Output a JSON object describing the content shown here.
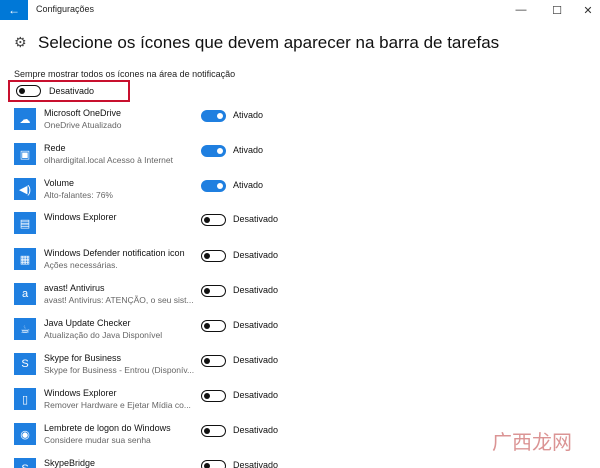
{
  "window": {
    "title": "Configurações",
    "back_icon": "←",
    "minimize_icon": "—",
    "maximize_icon": "☐",
    "close_icon": "✕"
  },
  "header": {
    "gear_icon": "⚙",
    "title": "Selecione os ícones que devem aparecer na barra de tarefas"
  },
  "always_show": {
    "label": "Sempre mostrar todos os ícones na área de notificação",
    "state": "Desativado",
    "on": false
  },
  "colors": {
    "accent": "#1f7fe0",
    "highlight_border": "#c8102e"
  },
  "items": [
    {
      "name": "Microsoft OneDrive",
      "desc": "OneDrive Atualizado",
      "state": "Ativado",
      "on": true,
      "icon": "☁"
    },
    {
      "name": "Rede",
      "desc": "olhardigital.local Acesso à Internet",
      "state": "Ativado",
      "on": true,
      "icon": "▣"
    },
    {
      "name": "Volume",
      "desc": "Alto-falantes: 76%",
      "state": "Ativado",
      "on": true,
      "icon": "◀)"
    },
    {
      "name": "Windows Explorer",
      "desc": "",
      "state": "Desativado",
      "on": false,
      "icon": "▤"
    },
    {
      "name": "Windows Defender notification icon",
      "desc": "Ações necessárias.",
      "state": "Desativado",
      "on": false,
      "icon": "▦"
    },
    {
      "name": "avast! Antivirus",
      "desc": "avast! Antivirus: ATENÇÃO, o seu sist...",
      "state": "Desativado",
      "on": false,
      "icon": "a"
    },
    {
      "name": "Java Update Checker",
      "desc": "Atualização do Java Disponível",
      "state": "Desativado",
      "on": false,
      "icon": "☕"
    },
    {
      "name": "Skype for Business",
      "desc": "Skype for Business - Entrou (Disponív...",
      "state": "Desativado",
      "on": false,
      "icon": "S"
    },
    {
      "name": "Windows Explorer",
      "desc": "Remover Hardware e Ejetar Mídia co...",
      "state": "Desativado",
      "on": false,
      "icon": "▯"
    },
    {
      "name": "Lembrete de logon do Windows",
      "desc": "Considere mudar sua senha",
      "state": "Desativado",
      "on": false,
      "icon": "◉"
    },
    {
      "name": "SkypeBridge",
      "desc": "",
      "state": "Desativado",
      "on": false,
      "icon": "S"
    }
  ],
  "watermark": "广西龙网"
}
